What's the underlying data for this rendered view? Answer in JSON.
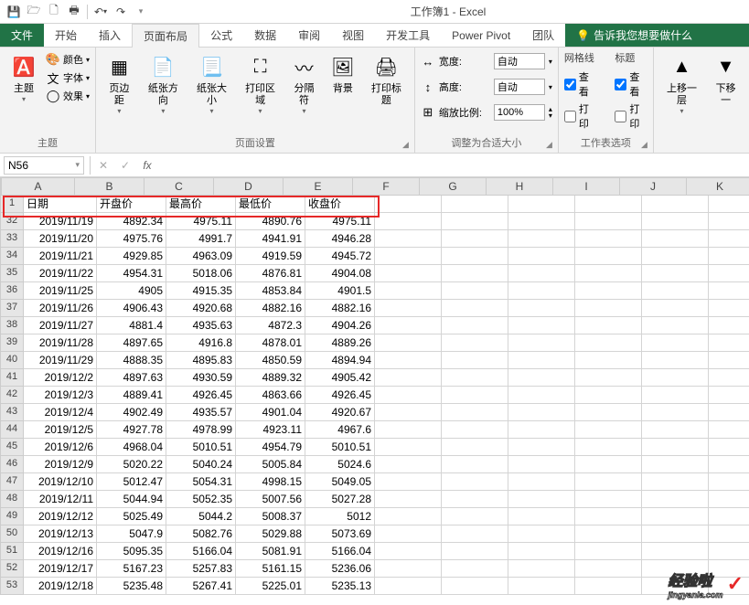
{
  "title": "工作簿1 - Excel",
  "tabs": {
    "file": "文件",
    "home": "开始",
    "insert": "插入",
    "pagelayout": "页面布局",
    "formulas": "公式",
    "data": "数据",
    "review": "审阅",
    "view": "视图",
    "developer": "开发工具",
    "powerpivot": "Power Pivot",
    "team": "团队",
    "tellme": "告诉我您想要做什么"
  },
  "ribbon": {
    "themes": {
      "main": "主题",
      "colors": "颜色",
      "fonts": "字体",
      "effects": "效果",
      "group": "主题"
    },
    "pagesetup": {
      "margins": "页边距",
      "orientation": "纸张方向",
      "size": "纸张大小",
      "printarea": "打印区域",
      "breaks": "分隔符",
      "background": "背景",
      "printtitles": "打印标题",
      "group": "页面设置"
    },
    "scaletofit": {
      "width_lbl": "宽度:",
      "width_val": "自动",
      "height_lbl": "高度:",
      "height_val": "自动",
      "scale_lbl": "缩放比例:",
      "scale_val": "100%",
      "group": "调整为合适大小"
    },
    "sheetoptions": {
      "gridlines": "网格线",
      "headings": "标题",
      "view": "查看",
      "print": "打印",
      "group": "工作表选项"
    },
    "arrange": {
      "bringfwd": "上移一层",
      "sendback": "下移一"
    }
  },
  "namebox": "N56",
  "columns": [
    "A",
    "B",
    "C",
    "D",
    "E",
    "F",
    "G",
    "H",
    "I",
    "J",
    "K"
  ],
  "header_row": [
    "日期",
    "开盘价",
    "最高价",
    "最低价",
    "收盘价"
  ],
  "row_numbers": [
    1,
    32,
    33,
    34,
    35,
    36,
    37,
    38,
    39,
    40,
    41,
    42,
    43,
    44,
    45,
    46,
    47,
    48,
    49,
    50,
    51,
    52,
    53
  ],
  "rows": [
    [
      "2019/11/19",
      "4892.34",
      "4975.11",
      "4890.76",
      "4975.11"
    ],
    [
      "2019/11/20",
      "4975.76",
      "4991.7",
      "4941.91",
      "4946.28"
    ],
    [
      "2019/11/21",
      "4929.85",
      "4963.09",
      "4919.59",
      "4945.72"
    ],
    [
      "2019/11/22",
      "4954.31",
      "5018.06",
      "4876.81",
      "4904.08"
    ],
    [
      "2019/11/25",
      "4905",
      "4915.35",
      "4853.84",
      "4901.5"
    ],
    [
      "2019/11/26",
      "4906.43",
      "4920.68",
      "4882.16",
      "4882.16"
    ],
    [
      "2019/11/27",
      "4881.4",
      "4935.63",
      "4872.3",
      "4904.26"
    ],
    [
      "2019/11/28",
      "4897.65",
      "4916.8",
      "4878.01",
      "4889.26"
    ],
    [
      "2019/11/29",
      "4888.35",
      "4895.83",
      "4850.59",
      "4894.94"
    ],
    [
      "2019/12/2",
      "4897.63",
      "4930.59",
      "4889.32",
      "4905.42"
    ],
    [
      "2019/12/3",
      "4889.41",
      "4926.45",
      "4863.66",
      "4926.45"
    ],
    [
      "2019/12/4",
      "4902.49",
      "4935.57",
      "4901.04",
      "4920.67"
    ],
    [
      "2019/12/5",
      "4927.78",
      "4978.99",
      "4923.11",
      "4967.6"
    ],
    [
      "2019/12/6",
      "4968.04",
      "5010.51",
      "4954.79",
      "5010.51"
    ],
    [
      "2019/12/9",
      "5020.22",
      "5040.24",
      "5005.84",
      "5024.6"
    ],
    [
      "2019/12/10",
      "5012.47",
      "5054.31",
      "4998.15",
      "5049.05"
    ],
    [
      "2019/12/11",
      "5044.94",
      "5052.35",
      "5007.56",
      "5027.28"
    ],
    [
      "2019/12/12",
      "5025.49",
      "5044.2",
      "5008.37",
      "5012"
    ],
    [
      "2019/12/13",
      "5047.9",
      "5082.76",
      "5029.88",
      "5073.69"
    ],
    [
      "2019/12/16",
      "5095.35",
      "5166.04",
      "5081.91",
      "5166.04"
    ],
    [
      "2019/12/17",
      "5167.23",
      "5257.83",
      "5161.15",
      "5236.06"
    ],
    [
      "2019/12/18",
      "5235.48",
      "5267.41",
      "5225.01",
      "5235.13"
    ]
  ],
  "watermark": {
    "text": "经验啦",
    "sub": "jingyanla.com"
  }
}
